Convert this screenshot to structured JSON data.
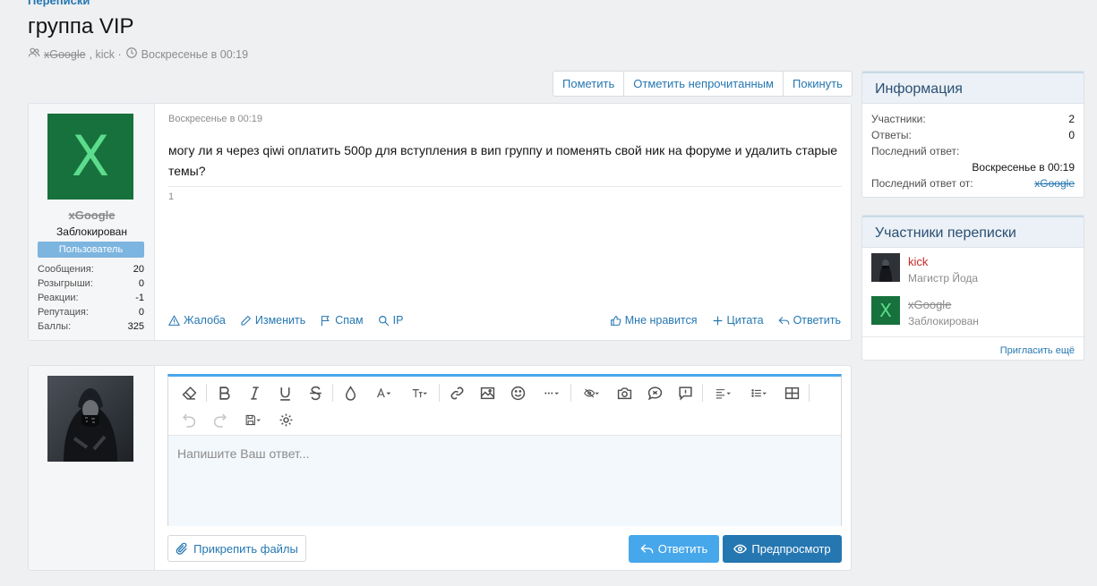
{
  "breadcrumb": "Переписки",
  "title": "группа VIP",
  "meta": {
    "participant1": "xGoogle",
    "participant2": ", kick ·",
    "date": "Воскресенье в 00:19"
  },
  "thread_buttons": {
    "mark": "Пометить",
    "mark_unread": "Отметить непрочитанным",
    "leave": "Покинуть"
  },
  "message": {
    "author": "xGoogle",
    "avatar_letter": "X",
    "user_title": "Заблокирован",
    "banner": "Пользователь",
    "stats": [
      {
        "label": "Сообщения:",
        "value": "20"
      },
      {
        "label": "Розыгрыши:",
        "value": "0"
      },
      {
        "label": "Реакции:",
        "value": "-1"
      },
      {
        "label": "Репутация:",
        "value": "0"
      },
      {
        "label": "Баллы:",
        "value": "325"
      }
    ],
    "date": "Воскресенье в 00:19",
    "text": "могу ли я через qiwi оплатить 500р для вступления в вип группу и поменять свой ник на форуме и удалить старые темы?",
    "number": "1",
    "actions": {
      "report": "Жалоба",
      "edit": "Изменить",
      "spam": "Спам",
      "ip": "IP",
      "like": "Мне нравится",
      "quote": "Цитата",
      "reply": "Ответить"
    }
  },
  "info": {
    "title": "Информация",
    "participants_label": "Участники:",
    "participants_value": "2",
    "replies_label": "Ответы:",
    "replies_value": "0",
    "last_reply_label": "Последний ответ:",
    "last_reply_value": "Воскресенье в 00:19",
    "last_reply_from_label": "Последний ответ от:",
    "last_reply_from_value": "xGoogle"
  },
  "participants_box": {
    "title": "Участники переписки",
    "items": [
      {
        "name": "kick",
        "sub": "Магистр Йода"
      },
      {
        "name": "xGoogle",
        "sub": "Заблокирован",
        "avatar_letter": "X"
      }
    ],
    "invite": "Пригласить ещё"
  },
  "reply": {
    "placeholder": "Напишите Ваш ответ...",
    "attach": "Прикрепить файлы",
    "reply_button": "Ответить",
    "preview_button": "Предпросмотр"
  },
  "colors": {
    "accent": "#2577b1",
    "accent_light": "#47a7eb",
    "avatar_green": "#17713c",
    "kick_red": "#c52a2a"
  }
}
